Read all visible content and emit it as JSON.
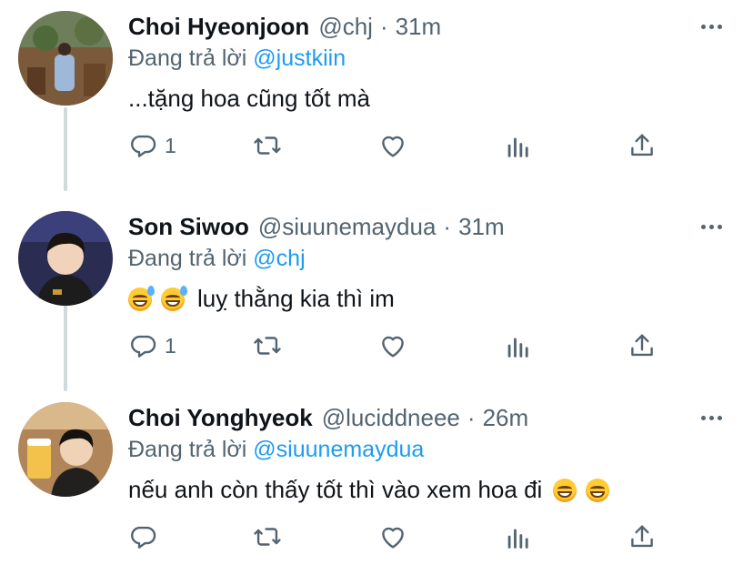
{
  "tweets": [
    {
      "name": "Choi Hyeonjoon",
      "handle": "@chj",
      "separator": "·",
      "time": "31m",
      "reply_prefix": "Đang trả lời",
      "reply_to": "@justkiin",
      "text": "...tặng hoa cũng tốt mà",
      "emojis_before": [],
      "emojis_after": [],
      "reply_count": "1",
      "avatar_icon": "avatar-photo-outdoor"
    },
    {
      "name": "Son Siwoo",
      "handle": "@siuunemaydua",
      "separator": "·",
      "time": "31m",
      "reply_prefix": "Đang trả lời",
      "reply_to": "@chj",
      "text": "luỵ thằng kia thì im",
      "emojis_before": [
        "grinning-sweat-emoji",
        "grinning-sweat-emoji"
      ],
      "emojis_after": [],
      "reply_count": "1",
      "avatar_icon": "avatar-photo-portrait"
    },
    {
      "name": "Choi Yonghyeok",
      "handle": "@luciddneee",
      "separator": "·",
      "time": "26m",
      "reply_prefix": "Đang trả lời",
      "reply_to": "@siuunemaydua",
      "text": "nếu anh còn thấy tốt thì vào xem hoa đi",
      "emojis_before": [],
      "emojis_after": [
        "grinning-emoji",
        "grinning-emoji"
      ],
      "reply_count": "",
      "avatar_icon": "avatar-photo-beer"
    }
  ],
  "icons": {
    "reply": "reply-icon",
    "retweet": "retweet-icon",
    "like": "heart-icon",
    "analytics": "analytics-icon",
    "share": "share-icon",
    "more": "more-icon"
  },
  "colors": {
    "text": "#0f1419",
    "secondary": "#536471",
    "link": "#1d9bf0",
    "thread_line": "#cfd9de"
  }
}
